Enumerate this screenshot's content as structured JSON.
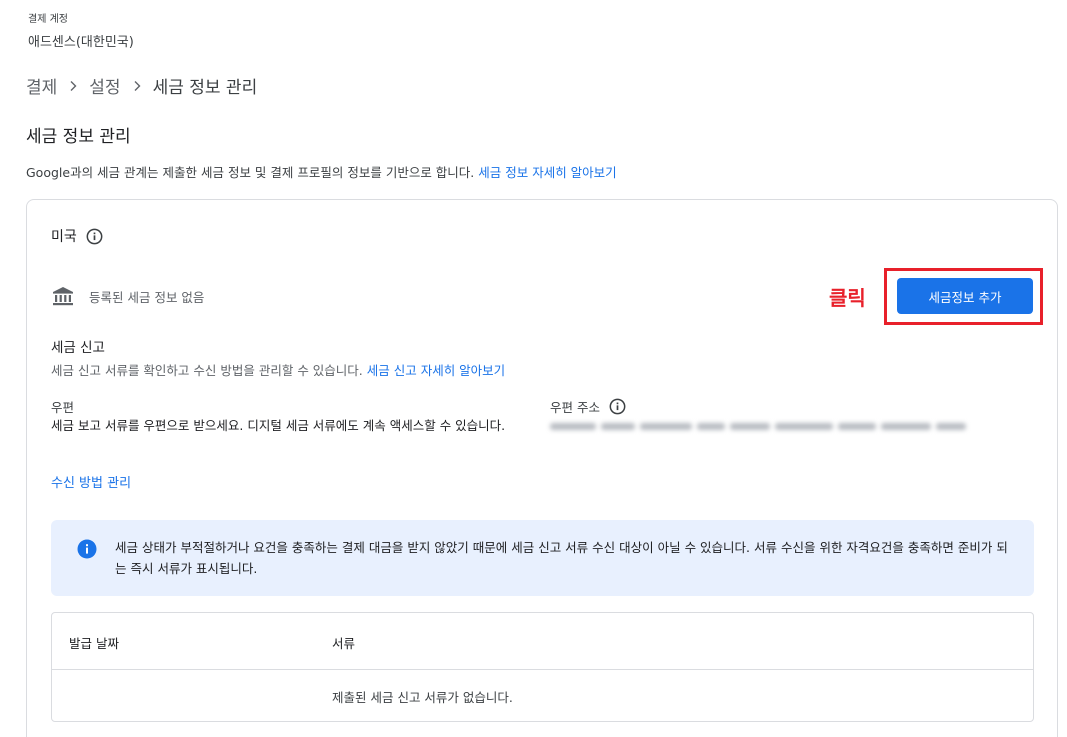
{
  "account": {
    "label": "결제 계정",
    "name": "애드센스(대한민국)"
  },
  "breadcrumb": {
    "items": [
      "결제",
      "설정",
      "세금 정보 관리"
    ]
  },
  "page": {
    "title": "세금 정보 관리",
    "intro_text": "Google과의 세금 관계는 제출한 세금 정보 및 결제 프로필의 정보를 기반으로 합니다. ",
    "intro_link": "세금 정보 자세히 알아보기"
  },
  "card": {
    "country": "미국",
    "tax_status": "등록된 세금 정보 없음",
    "annotation": "클릭",
    "add_button": "세금정보 추가",
    "filing_title": "세금 신고",
    "filing_desc": "세금 신고 서류를 확인하고 수신 방법을 관리할 수 있습니다. ",
    "filing_link": "세금 신고 자세히 알아보기",
    "mail_label": "우편",
    "mail_desc": "세금 보고 서류를 우편으로 받으세요. 디지털 세금 서류에도 계속 액세스할 수 있습니다.",
    "address_label": "우편 주소",
    "manage_link": "수신 방법 관리",
    "notice": "세금 상태가 부적절하거나 요건을 충족하는 결제 대금을 받지 않았기 때문에 세금 신고 서류 수신 대상이 아닐 수 있습니다. 서류 수신을 위한 자격요건을 충족하면 준비가 되는 즉시 서류가 표시됩니다.",
    "table": {
      "col_date": "발급 날짜",
      "col_document": "서류",
      "empty": "제출된 세금 신고 서류가 없습니다."
    }
  },
  "icons": {
    "info": "info-circle-icon",
    "bank": "bank-icon",
    "chevron": "chevron-right-icon"
  },
  "colors": {
    "primary": "#1a73e8",
    "annotation": "#e8202a",
    "notice_bg": "#e8f0fe"
  }
}
